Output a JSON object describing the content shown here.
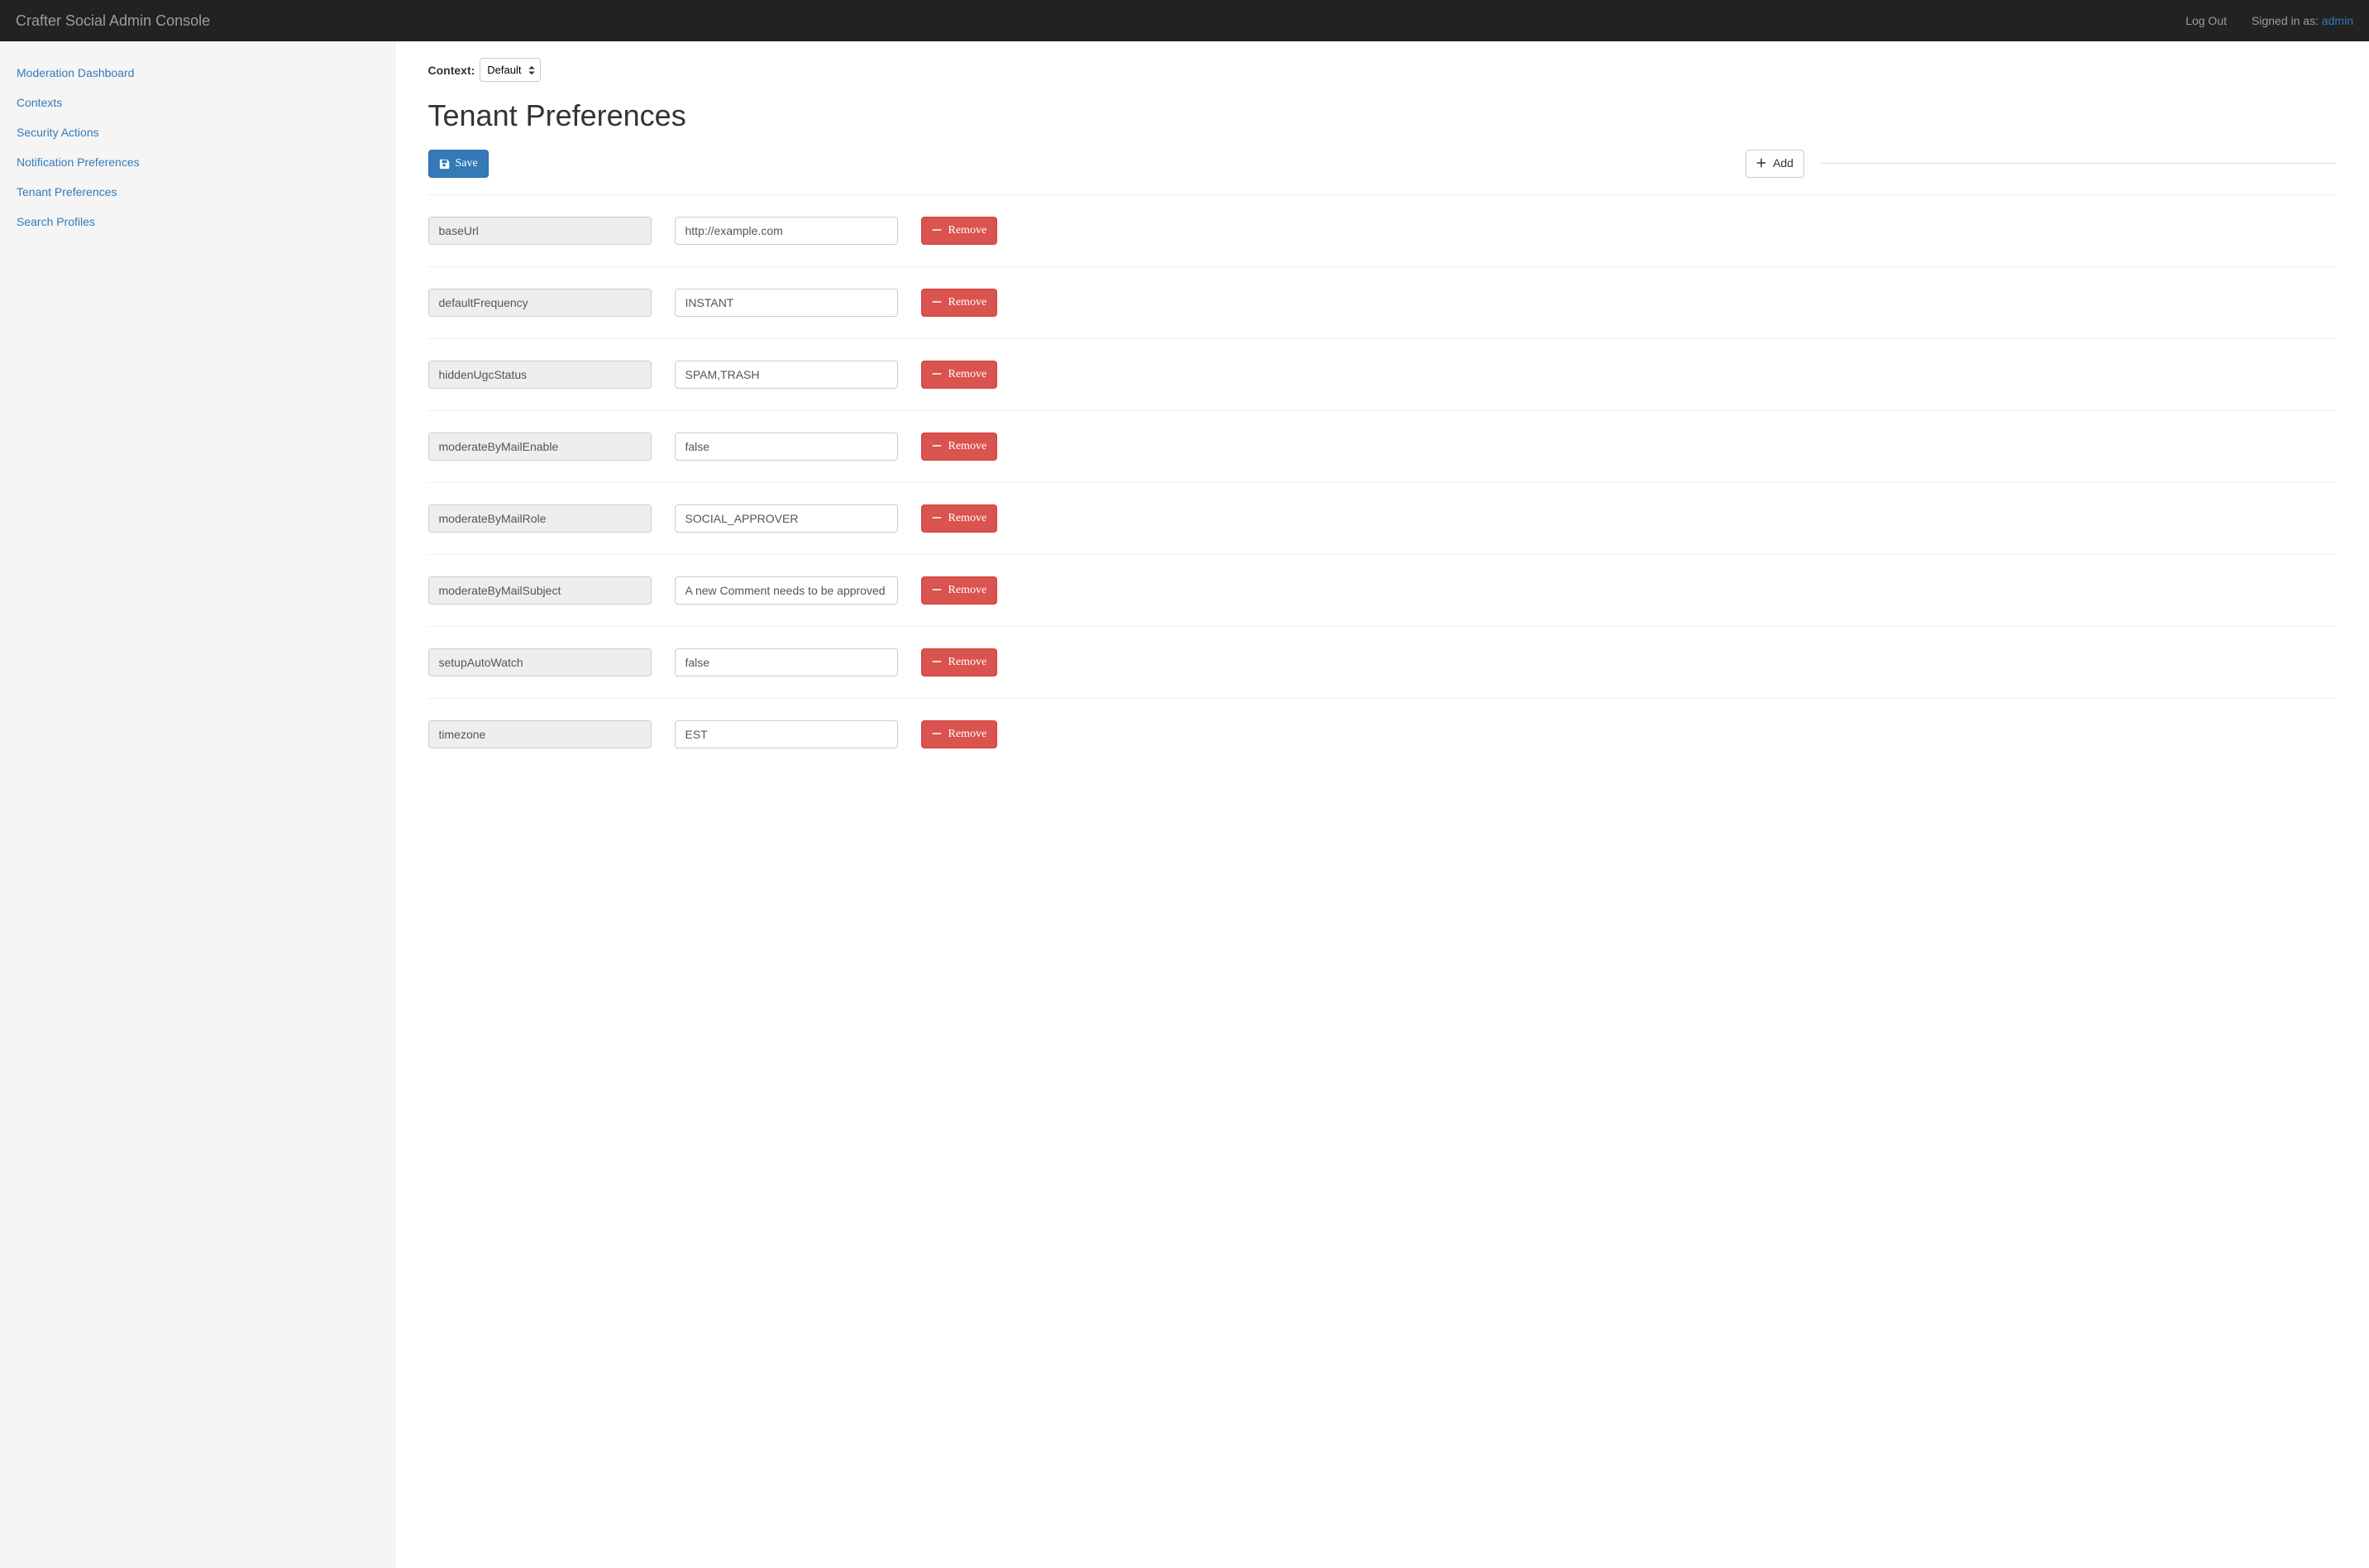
{
  "navbar": {
    "brand": "Crafter Social Admin Console",
    "log_out": "Log Out",
    "signed_in_prefix": "Signed in as: ",
    "username": "admin"
  },
  "sidebar": {
    "items": [
      {
        "label": "Moderation Dashboard"
      },
      {
        "label": "Contexts"
      },
      {
        "label": "Security Actions"
      },
      {
        "label": "Notification Preferences"
      },
      {
        "label": "Tenant Preferences"
      },
      {
        "label": "Search Profiles"
      }
    ]
  },
  "context": {
    "label": "Context:",
    "selected": "Default"
  },
  "page": {
    "title": "Tenant Preferences",
    "save_label": "Save",
    "add_label": "Add",
    "remove_label": "Remove"
  },
  "prefs": [
    {
      "key": "baseUrl",
      "value": "http://example.com"
    },
    {
      "key": "defaultFrequency",
      "value": "INSTANT"
    },
    {
      "key": "hiddenUgcStatus",
      "value": "SPAM,TRASH"
    },
    {
      "key": "moderateByMailEnable",
      "value": "false"
    },
    {
      "key": "moderateByMailRole",
      "value": "SOCIAL_APPROVER"
    },
    {
      "key": "moderateByMailSubject",
      "value": "A new Comment needs to be approved"
    },
    {
      "key": "setupAutoWatch",
      "value": "false"
    },
    {
      "key": "timezone",
      "value": "EST"
    }
  ]
}
